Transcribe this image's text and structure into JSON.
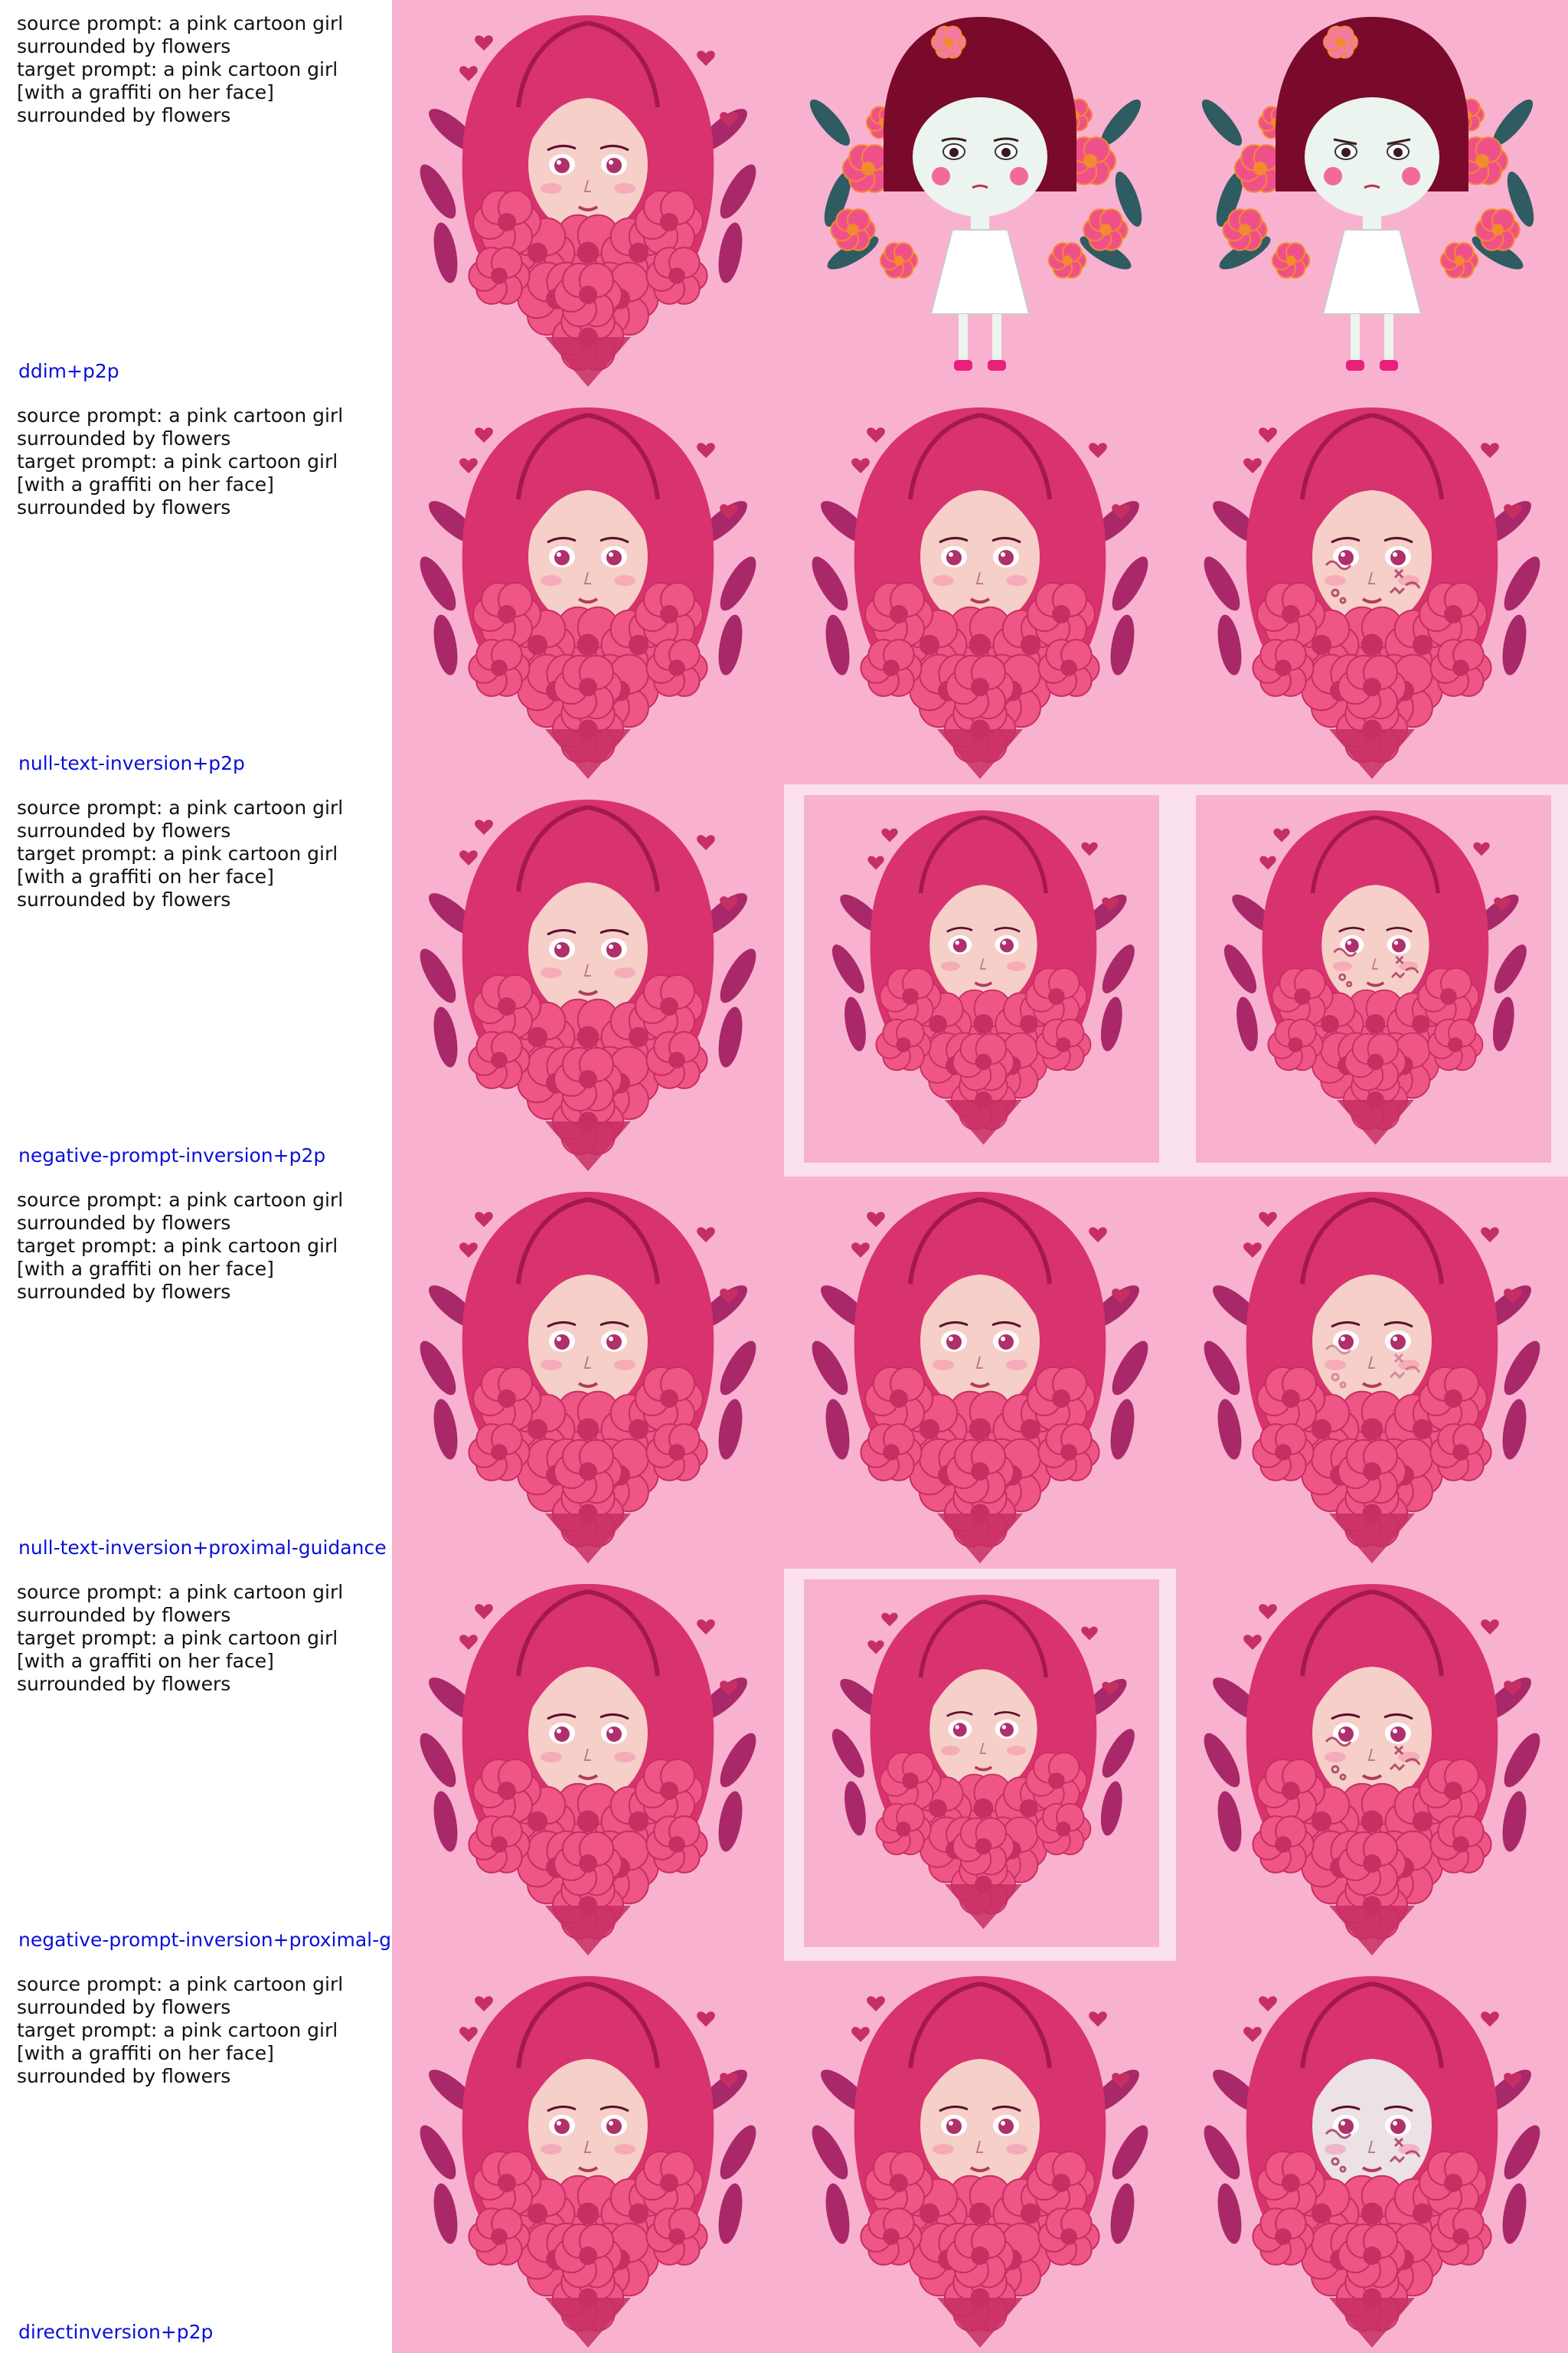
{
  "colors": {
    "bg_pink": "#f8b2cf",
    "bg_pink_light": "#fbc8dc",
    "frame_pale": "#fbe1ee",
    "hair": "#d8336e",
    "hair_dark": "#a4194d",
    "skin": "#f7cfc9",
    "skin_pale": "#ece2e6",
    "flower": "#ef5585",
    "flower_dark": "#c52f62",
    "leaf": "#a8286a",
    "cartoon_hair": "#7a0a2c",
    "cartoon_face": "#ebf4ef",
    "cartoon_leaf": "#2f5b63",
    "graffiti": "#a93a62",
    "method_text": "#0a10d8"
  },
  "rows": [
    {
      "prompt_text": "source prompt: a pink cartoon girl\nsurrounded by flowers\ntarget prompt: a pink cartoon girl\n[with a graffiti on her face]\nsurrounded by flowers",
      "method": "ddim+p2p",
      "images": [
        {
          "icon": "pink-girl-flowers-image",
          "style": "heart"
        },
        {
          "icon": "cartoon-girl-flowers-image",
          "style": "cartoon"
        },
        {
          "icon": "cartoon-girl-flowers-edited-image",
          "style": "cartoon-edited"
        }
      ]
    },
    {
      "prompt_text": "source prompt: a pink cartoon girl\nsurrounded by flowers\ntarget prompt: a pink cartoon girl\n[with a graffiti on her face]\nsurrounded by flowers",
      "method": "null-text-inversion+p2p",
      "images": [
        {
          "icon": "pink-girl-flowers-image",
          "style": "heart"
        },
        {
          "icon": "pink-girl-reconstruction-image",
          "style": "heart"
        },
        {
          "icon": "pink-girl-graffiti-image",
          "style": "heart-graffiti"
        }
      ]
    },
    {
      "prompt_text": "source prompt: a pink cartoon girl\nsurrounded by flowers\ntarget prompt: a pink cartoon girl\n[with a graffiti on her face]\nsurrounded by flowers",
      "method": "negative-prompt-inversion+p2p",
      "images": [
        {
          "icon": "pink-girl-flowers-image",
          "style": "heart"
        },
        {
          "icon": "pink-girl-framed-reconstruction-image",
          "style": "framed"
        },
        {
          "icon": "pink-girl-framed-graffiti-image",
          "style": "framed-graffiti"
        }
      ]
    },
    {
      "prompt_text": "source prompt: a pink cartoon girl\nsurrounded by flowers\ntarget prompt: a pink cartoon girl\n[with a graffiti on her face]\nsurrounded by flowers",
      "method": "null-text-inversion+proximal-guidance",
      "images": [
        {
          "icon": "pink-girl-flowers-image",
          "style": "heart"
        },
        {
          "icon": "pink-girl-reconstruction-image",
          "style": "heart"
        },
        {
          "icon": "pink-girl-graffiti-image",
          "style": "heart-graffiti-light"
        }
      ]
    },
    {
      "prompt_text": "source prompt: a pink cartoon girl\nsurrounded by flowers\ntarget prompt: a pink cartoon girl\n[with a graffiti on her face]\nsurrounded by flowers",
      "method": "negative-prompt-inversion+proximal-g",
      "images": [
        {
          "icon": "pink-girl-flowers-image",
          "style": "heart"
        },
        {
          "icon": "pink-girl-framed-reconstruction-image",
          "style": "framed"
        },
        {
          "icon": "pink-girl-graffiti-image",
          "style": "heart-graffiti"
        }
      ]
    },
    {
      "prompt_text": "source prompt: a pink cartoon girl\nsurrounded by flowers\ntarget prompt: a pink cartoon girl\n[with a graffiti on her face]\nsurrounded by flowers",
      "method": "directinversion+p2p",
      "images": [
        {
          "icon": "pink-girl-flowers-image",
          "style": "heart"
        },
        {
          "icon": "pink-girl-reconstruction-image",
          "style": "heart"
        },
        {
          "icon": "pink-girl-graffiti-image",
          "style": "heart-graffiti-pale"
        }
      ]
    }
  ]
}
